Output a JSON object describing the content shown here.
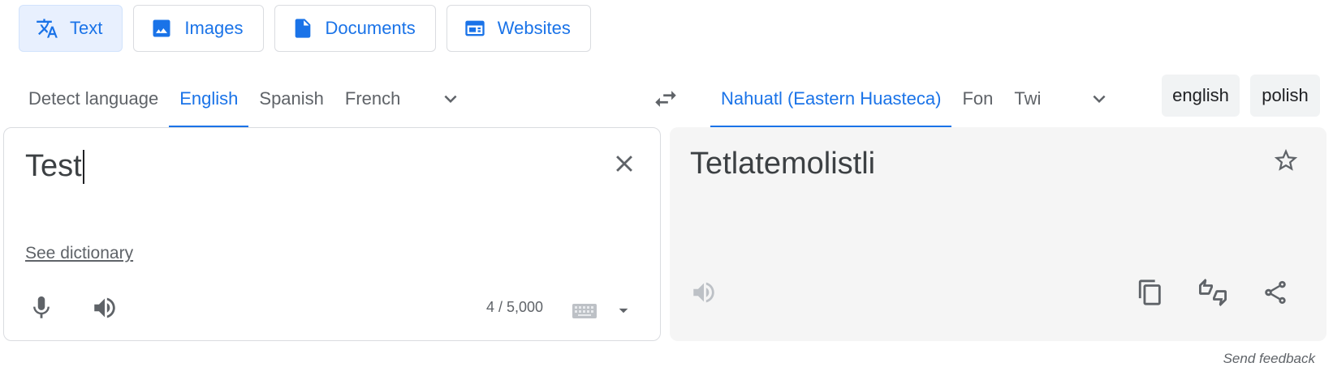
{
  "modes": [
    {
      "label": "Text",
      "icon": "translate-icon",
      "active": true
    },
    {
      "label": "Images",
      "icon": "image-icon",
      "active": false
    },
    {
      "label": "Documents",
      "icon": "document-icon",
      "active": false
    },
    {
      "label": "Websites",
      "icon": "web-icon",
      "active": false
    }
  ],
  "source_languages": [
    {
      "label": "Detect language",
      "active": false
    },
    {
      "label": "English",
      "active": true
    },
    {
      "label": "Spanish",
      "active": false
    },
    {
      "label": "French",
      "active": false
    }
  ],
  "target_languages": [
    {
      "label": "Nahuatl (Eastern Huasteca)",
      "active": true
    },
    {
      "label": "Fon",
      "active": false
    },
    {
      "label": "Twi",
      "active": false
    }
  ],
  "chips": [
    "english",
    "polish"
  ],
  "source": {
    "text": "Test",
    "see_dictionary": "See dictionary",
    "char_count": "4 / 5,000"
  },
  "target": {
    "text": "Tetlatemolistli"
  },
  "footer": {
    "send_feedback": "Send feedback"
  },
  "colors": {
    "accent": "#1a73e8",
    "active_tab_bg": "#e8f0fe",
    "target_panel_bg": "#f5f5f5",
    "icon_gray": "#5f6368"
  }
}
